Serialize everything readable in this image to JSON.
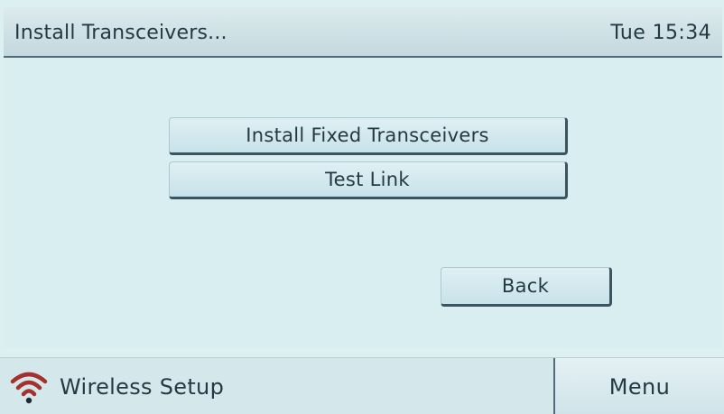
{
  "header": {
    "title": "Install Transceivers...",
    "datetime": "Tue 15:34"
  },
  "main": {
    "buttons": {
      "install_fixed": "Install Fixed Transceivers",
      "test_link": "Test Link",
      "back": "Back"
    }
  },
  "footer": {
    "wireless_label": "Wireless Setup",
    "wifi_icon": "wifi-icon",
    "menu_label": "Menu"
  },
  "colors": {
    "background": "#d9eef1",
    "text": "#233a44",
    "wifi_accent": "#a3322e",
    "button_shadow": "#3b5560"
  }
}
